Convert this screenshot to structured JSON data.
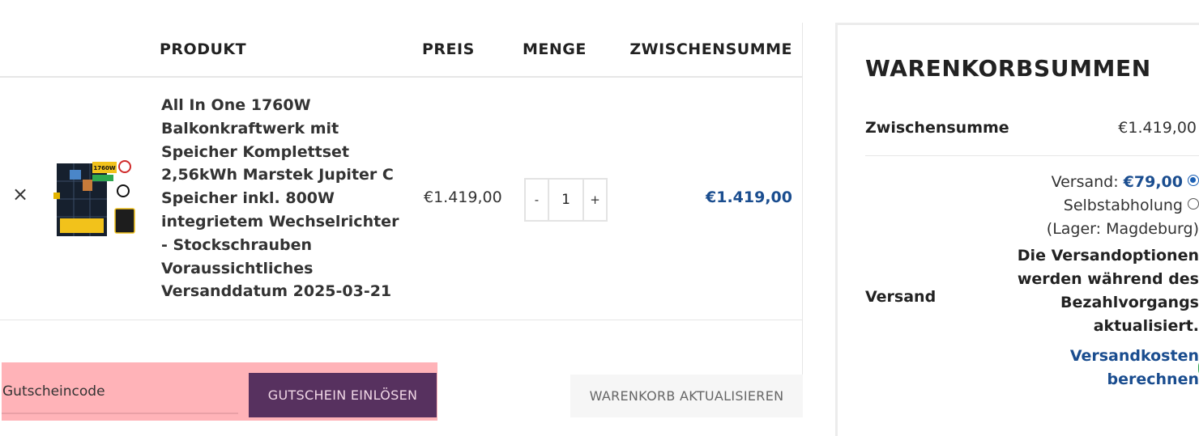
{
  "table": {
    "headers": {
      "product": "PRODUKT",
      "price": "PREIS",
      "quantity": "MENGE",
      "subtotal": "ZWISCHENSUMME"
    }
  },
  "cart_item": {
    "remove_icon": "close-icon",
    "remove_glyph": "×",
    "image_label": "1760W",
    "name": "All In One 1760W Balkonkraftwerk mit Speicher Komplettset 2,56kWh Marstek Jupiter C Speicher inkl. 800W integrietem Wechselrichter - Stockschrauben Voraussichtliches Versanddatum 2025-03-21",
    "price": "€1.419,00",
    "quantity": "1",
    "minus_label": "-",
    "plus_label": "+",
    "subtotal": "€1.419,00"
  },
  "actions": {
    "coupon_placeholder": "Gutscheincode",
    "coupon_button": "GUTSCHEIN EINLÖSEN",
    "update_button": "WARENKORB AKTUALISIEREN"
  },
  "totals": {
    "title": "WARENKORBSUMMEN",
    "subtotal_label": "Zwischensumme",
    "subtotal_value": "€1.419,00",
    "shipping_label": "Versand",
    "shipping_option_prefix": "Versand: ",
    "shipping_option_price": "€79,00",
    "pickup_option": "Selbstabholung",
    "pickup_location": "(Lager: Magdeburg)",
    "shipping_note": "Die Versandoptionen werden während des Bezahlvorgangs aktualisiert.",
    "calc_link": "Versandkosten berechnen"
  },
  "colors": {
    "accent_blue": "#1a4d8f",
    "coupon_button_bg": "#57315f",
    "coupon_highlight": "#ffb3b8"
  }
}
